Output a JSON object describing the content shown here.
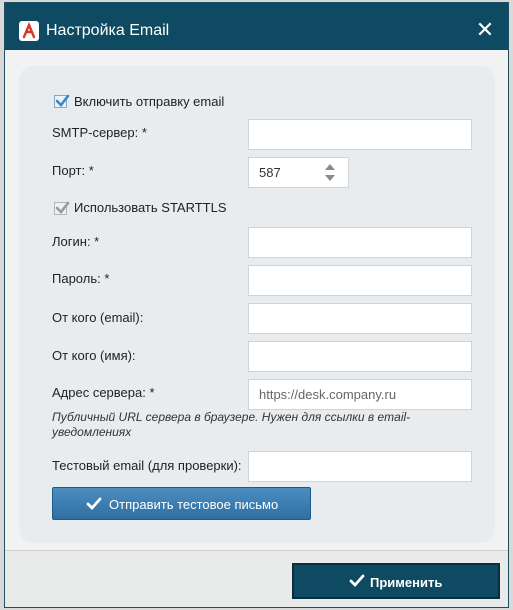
{
  "dialog": {
    "title": "Настройка Email",
    "close_label": "✕"
  },
  "form": {
    "enable_email_label": "Включить отправку email",
    "smtp_server_label": "SMTP-сервер: *",
    "smtp_server_value": "",
    "port_label": "Порт: *",
    "port_value": "587",
    "starttls_label": "Использовать STARTTLS",
    "login_label": "Логин: *",
    "login_value": "",
    "password_label": "Пароль: *",
    "password_value": "",
    "from_email_label": "От кого (email):",
    "from_email_value": "",
    "from_name_label": "От кого (имя):",
    "from_name_value": "",
    "server_address_label": "Адрес сервера: *",
    "server_address_placeholder": "https://desk.company.ru",
    "server_address_hint": "Публичный URL сервера в браузере. Нужен для ссылки в email-уведомлениях",
    "test_email_label": "Тестовый email (для проверки):",
    "test_email_value": "",
    "send_test_label": "Отправить тестовое письмо"
  },
  "footer": {
    "apply_label": "Применить"
  },
  "colors": {
    "titlebar": "#0e4a61",
    "primary_button": "#0e4a61",
    "test_button": "#2f6fa3"
  },
  "state": {
    "enable_email_checked": true,
    "starttls_checked": true
  }
}
